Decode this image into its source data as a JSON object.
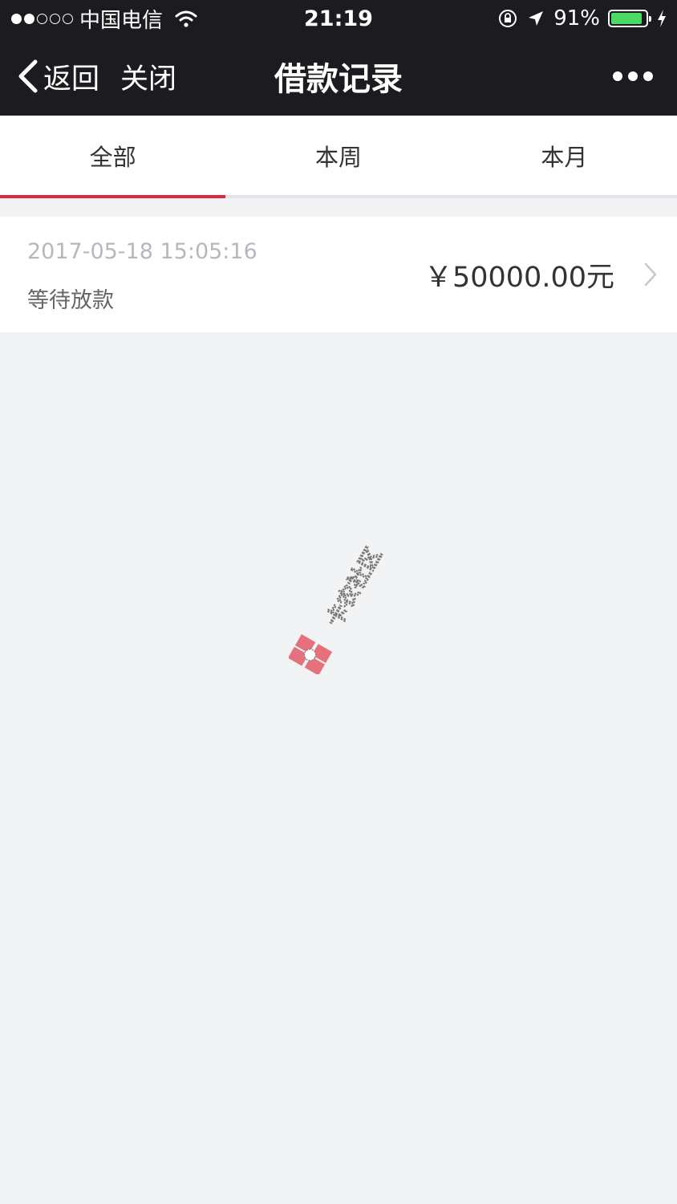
{
  "status_bar": {
    "carrier": "中国电信",
    "time": "21:19",
    "battery_percent": "91%",
    "battery_level": 0.91,
    "signal_bars_filled": 2,
    "signal_bars_total": 5
  },
  "nav": {
    "back_label": "返回",
    "close_label": "关闭",
    "title": "借款记录"
  },
  "tabs": [
    {
      "label": "全部",
      "active": true
    },
    {
      "label": "本周",
      "active": false
    },
    {
      "label": "本月",
      "active": false
    }
  ],
  "records": [
    {
      "datetime": "2017-05-18 15:05:16",
      "status": "等待放款",
      "amount": "￥50000.00元"
    }
  ],
  "watermark": {
    "text": "卡农社区"
  },
  "colors": {
    "bar_bg": "#1c1c20",
    "accent": "#dd2a3b",
    "page_bg": "#f2f3f5",
    "battery_fill": "#4cd964"
  }
}
